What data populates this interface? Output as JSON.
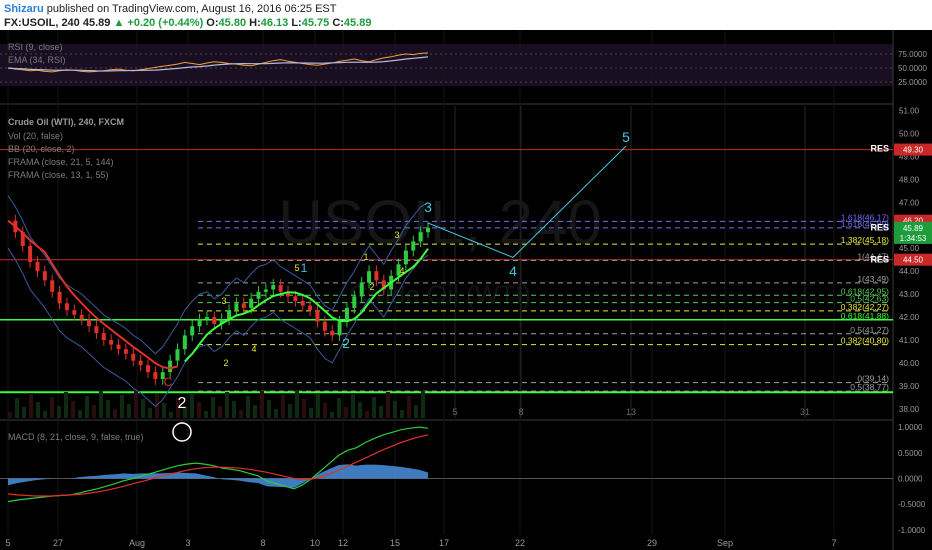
{
  "header": {
    "author": "Shizaru",
    "published": "published on TradingView.com, August 16, 2016 06:25 EST",
    "symbol": "FX:USOIL, 240",
    "last": "45.89",
    "change": "▲ +0.20 (+0.44%)",
    "o_label": "O:",
    "o": "45.80",
    "h_label": "H:",
    "h": "46.13",
    "l_label": "L:",
    "l": "45.75",
    "c_label": "C:",
    "c": "45.89"
  },
  "panes": {
    "rsi_title": "RSI (9, close)",
    "rsi_ema": "EMA (34, RSI)",
    "main_title": "Crude Oil (WTI), 240, FXCM",
    "vol": "Vol (20, false)",
    "bb": "BB (20, close, 2)",
    "frama1": "FRAMA (close, 21, 5, 144)",
    "frama2": "FRAMA (close, 13, 1, 55)",
    "macd_title": "MACD (8, 21, close, 9, false, true)",
    "watermark": "USOIL, 240",
    "watermark2": "Crude Oil (WTI)"
  },
  "colors": {
    "up": "#2ecc40",
    "down": "#e0302a",
    "frama_red": "#e0302a",
    "frama_green": "#3cff3c",
    "bb": "#3a5a9a",
    "rsi": "#f0a040",
    "rsi_ema": "#b8b8d8",
    "wave": "#40c8e0",
    "fib_yellow": "#e8e83a",
    "fib_gray": "#a0a0a0",
    "macd_hist": "#4a90e0",
    "macd_line": "#2ecc40",
    "signal": "#e0302a",
    "res": "#c82828"
  },
  "chart_data": {
    "type": "candlestick",
    "x_ticks": [
      "5",
      "27",
      "Aug",
      "3",
      "8",
      "10",
      "12",
      "15",
      "17",
      "22",
      "29",
      "Sep",
      "7"
    ],
    "date_markers": [
      "5",
      "8",
      "13",
      "31"
    ],
    "y_ticks_price": [
      "51.00",
      "50.00",
      "49.00",
      "48.00",
      "47.00",
      "46.00",
      "45.00",
      "44.00",
      "43.00",
      "42.00",
      "41.00",
      "40.00",
      "39.00",
      "38.00"
    ],
    "y_ticks_rsi": [
      "75.0000",
      "50.0000",
      "25.0000"
    ],
    "y_ticks_macd": [
      "1.0000",
      "0.5000",
      "0.0000",
      "-0.5000",
      "-1.0000"
    ],
    "price_badges": [
      {
        "label": "49.30",
        "price": 49.3,
        "color": "#c82828"
      },
      {
        "label": "46.20",
        "price": 46.2,
        "color": "#c82828"
      },
      {
        "label": "45.89",
        "price": 45.89,
        "color": "#1e9c3c"
      },
      {
        "label": "1:34:53",
        "price": 45.45,
        "color": "#1e9c3c"
      },
      {
        "label": "44.50",
        "price": 44.5,
        "color": "#c82828"
      }
    ],
    "res_labels": [
      {
        "text": "RES",
        "price": 49.35
      },
      {
        "text": "RES",
        "price": 45.9
      },
      {
        "text": "RES",
        "price": 44.5
      }
    ],
    "fib_levels": [
      {
        "label": "1.618(46.17)",
        "price": 46.17,
        "color": "#7070f0"
      },
      {
        "label": "1.618(45.89)",
        "price": 45.89,
        "color": "#7070f0"
      },
      {
        "label": "1.382(45.18)",
        "price": 45.18,
        "color": "#e8e83a"
      },
      {
        "label": "1(44.47)",
        "price": 44.47,
        "color": "#a0a0a0"
      },
      {
        "label": "1(43.49)",
        "price": 43.49,
        "color": "#a0a0a0"
      },
      {
        "label": "0.618(42.95)",
        "price": 42.95,
        "color": "#5ac85a"
      },
      {
        "label": "0.5(42.63)",
        "price": 42.63,
        "color": "#5ac85a"
      },
      {
        "label": "0.382(42.27)",
        "price": 42.27,
        "color": "#e8e83a"
      },
      {
        "label": "0.618(41.88)",
        "price": 41.88,
        "color": "#3cff3c"
      },
      {
        "label": "0.5(41.27)",
        "price": 41.27,
        "color": "#a0a0a0"
      },
      {
        "label": "0.382(40.80)",
        "price": 40.8,
        "color": "#e8e83a"
      },
      {
        "label": "0(39.14)",
        "price": 39.14,
        "color": "#a0a0a0"
      },
      {
        "label": "0.5(38.77)",
        "price": 38.77,
        "color": "#a0a0a0"
      }
    ],
    "wave_labels": [
      {
        "text": "C",
        "color": "#e0302a"
      },
      {
        "text": "2",
        "color": "#ffffff"
      },
      {
        "text": "3",
        "color": "#e8e83a"
      },
      {
        "text": "2",
        "color": "#e8e83a"
      },
      {
        "text": "4",
        "color": "#e8e83a"
      },
      {
        "text": "5",
        "color": "#e8e83a"
      },
      {
        "text": "1",
        "color": "#40c8e0"
      },
      {
        "text": "2",
        "color": "#40c8e0"
      },
      {
        "text": "1",
        "color": "#e8e83a"
      },
      {
        "text": "2",
        "color": "#e8e83a"
      },
      {
        "text": "3",
        "color": "#e8e83a"
      },
      {
        "text": "4",
        "color": "#e8e83a"
      },
      {
        "text": "3",
        "color": "#40c8e0"
      },
      {
        "text": "4",
        "color": "#40c8e0"
      },
      {
        "text": "5",
        "color": "#40c8e0"
      }
    ],
    "price_path": [
      46.2,
      45.7,
      45.1,
      44.4,
      44.0,
      43.6,
      43.1,
      42.6,
      42.3,
      42.1,
      41.9,
      41.6,
      41.3,
      41.0,
      40.8,
      40.6,
      40.4,
      40.1,
      39.9,
      39.6,
      39.3,
      39.6,
      40.1,
      40.6,
      41.2,
      41.6,
      41.9,
      42.0,
      41.7,
      41.9,
      42.3,
      42.6,
      42.4,
      42.8,
      43.1,
      43.2,
      43.4,
      43.1,
      42.9,
      42.7,
      42.5,
      42.3,
      41.8,
      41.4,
      41.2,
      41.8,
      42.4,
      42.9,
      43.5,
      44.0,
      43.6,
      43.2,
      43.8,
      44.3,
      44.9,
      45.3,
      45.7,
      45.89
    ],
    "projection": [
      {
        "label": "3",
        "price": 46.3
      },
      {
        "label": "4",
        "price": 44.6
      },
      {
        "label": "5",
        "price": 49.45
      }
    ],
    "rsi_values": [
      50,
      48,
      47,
      45,
      46,
      44,
      43,
      45,
      47,
      46,
      44,
      43,
      44,
      45,
      47,
      48,
      46,
      45,
      47,
      49,
      51,
      53,
      55,
      57,
      60,
      58,
      56,
      59,
      61,
      60,
      58,
      57,
      55,
      54,
      57,
      60,
      63,
      65,
      62,
      60,
      58,
      56,
      55,
      57,
      59,
      62,
      64,
      66,
      63,
      61,
      65,
      68,
      70,
      73,
      75,
      74,
      76,
      77
    ],
    "macd_values": [
      -0.45,
      -0.42,
      -0.4,
      -0.38,
      -0.36,
      -0.34,
      -0.33,
      -0.32,
      -0.28,
      -0.24,
      -0.2,
      -0.15,
      -0.1,
      -0.04,
      0.0,
      0.05,
      0.1,
      0.15,
      0.2,
      0.25,
      0.28,
      0.3,
      0.28,
      0.25,
      0.2,
      0.18,
      0.15,
      0.1,
      0.05,
      -0.05,
      -0.1,
      -0.15,
      -0.2,
      -0.12,
      0.0,
      0.15,
      0.3,
      0.45,
      0.55,
      0.6,
      0.7,
      0.78,
      0.85,
      0.9,
      0.95,
      0.98,
      1.0,
      0.98
    ],
    "signal_values": [
      -0.3,
      -0.32,
      -0.33,
      -0.34,
      -0.34,
      -0.34,
      -0.33,
      -0.32,
      -0.31,
      -0.29,
      -0.26,
      -0.23,
      -0.19,
      -0.15,
      -0.1,
      -0.06,
      -0.01,
      0.04,
      0.08,
      0.12,
      0.16,
      0.19,
      0.21,
      0.22,
      0.22,
      0.21,
      0.2,
      0.18,
      0.15,
      0.12,
      0.08,
      0.04,
      0.0,
      -0.02,
      -0.01,
      0.03,
      0.09,
      0.16,
      0.24,
      0.32,
      0.4,
      0.48,
      0.56,
      0.63,
      0.7,
      0.76,
      0.81,
      0.85
    ]
  }
}
